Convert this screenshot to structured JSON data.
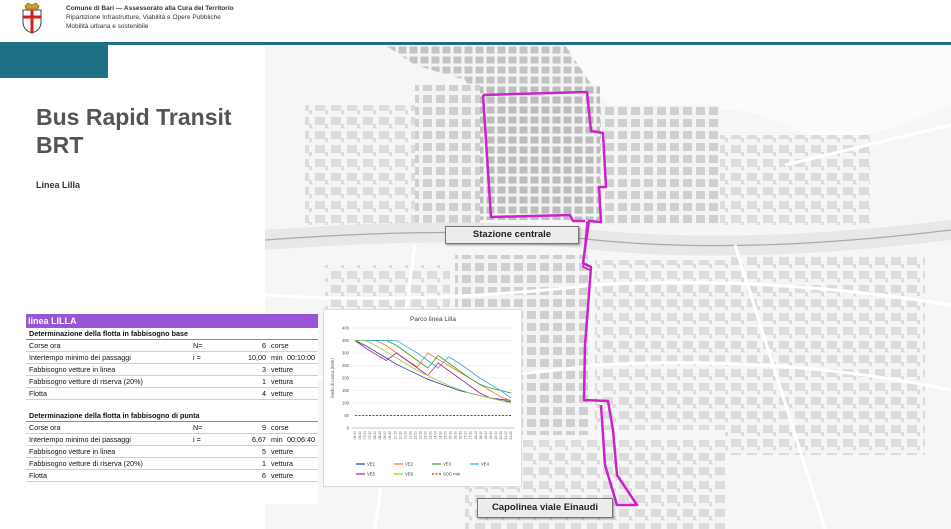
{
  "header": {
    "line1": "Comune di Bari — Assessorato alla Cura del Territorio",
    "line2": "Ripartizione Infrastrutture, Viabilità e Opere Pubbliche",
    "line3": "Mobilità urbana e sostenibile"
  },
  "page": {
    "title_line1": "Bus Rapid Transit",
    "title_line2": "BRT",
    "subtitle": "Linea Lilla"
  },
  "map": {
    "route_color": "#cc22cc",
    "label_station": "Stazione centrale",
    "label_terminal": "Capolinea viale Einaudi"
  },
  "table": {
    "header": "linea LILLA",
    "header_color": "#9955d8",
    "base": {
      "section_title": "Determinazione della flotta in fabbisogno base",
      "rows": [
        {
          "label": "Corse ora",
          "sym": "N=",
          "val": "6",
          "unit": "corse",
          "time": ""
        },
        {
          "label": "Intertempo minimo dei passaggi",
          "sym": "i =",
          "val": "10,00",
          "unit": "min",
          "time": "00:10:00"
        },
        {
          "label": "Fabbisogno vetture in linea",
          "sym": "",
          "val": "3",
          "unit": "vetture",
          "time": ""
        },
        {
          "label": "Fabbisogno vetture di riserva (20%)",
          "sym": "",
          "val": "1",
          "unit": "vettura",
          "time": ""
        },
        {
          "label": "Flotta",
          "sym": "",
          "val": "4",
          "unit": "vetture",
          "time": ""
        }
      ]
    },
    "peak": {
      "section_title": "Determinazione della flotta in fabbisogno di punta",
      "rows": [
        {
          "label": "Corse ora",
          "sym": "N=",
          "val": "9",
          "unit": "corse",
          "time": ""
        },
        {
          "label": "Intertempo minimo dei passaggi",
          "sym": "i =",
          "val": "6,67",
          "unit": "min",
          "time": "00:06:40"
        },
        {
          "label": "Fabbisogno vetture in linea",
          "sym": "",
          "val": "5",
          "unit": "vetture",
          "time": ""
        },
        {
          "label": "Fabbisogno vetture di riserva (20%)",
          "sym": "",
          "val": "1",
          "unit": "vettura",
          "time": ""
        },
        {
          "label": "Flotta",
          "sym": "",
          "val": "6",
          "unit": "vetture",
          "time": ""
        }
      ]
    }
  },
  "chart_data": {
    "type": "line",
    "title": "Parco linea Lilla",
    "ylabel": "livello di carica (kWh)",
    "ylim": [
      0,
      400
    ],
    "yticks": [
      0,
      50,
      100,
      150,
      200,
      250,
      300,
      350,
      400
    ],
    "categories": [
      "06:00",
      "06:30",
      "07:00",
      "07:30",
      "08:00",
      "08:30",
      "09:00",
      "09:30",
      "10:00",
      "10:30",
      "11:00",
      "11:30",
      "12:00",
      "12:30",
      "13:00",
      "13:30",
      "14:00",
      "14:30",
      "15:00",
      "15:30",
      "16:00",
      "16:30",
      "17:00",
      "17:30",
      "18:00",
      "18:30",
      "19:00",
      "19:30",
      "20:00",
      "20:30",
      "21:00",
      "21:30"
    ],
    "series": [
      {
        "name": "VE1",
        "color": "#1f3fa0",
        "values": [
          350,
          330,
          305,
          280,
          255,
          235,
          215,
          195,
          180,
          165,
          150,
          140,
          130,
          120,
          115,
          110
        ]
      },
      {
        "name": "VE2",
        "color": "#ee7722",
        "values": [
          350,
          350,
          350,
          330,
          300,
          270,
          245,
          300,
          275,
          250,
          225,
          200,
          175,
          150,
          125,
          110
        ]
      },
      {
        "name": "VE3",
        "color": "#33a02c",
        "values": [
          350,
          350,
          350,
          350,
          330,
          300,
          270,
          240,
          290,
          260,
          230,
          200,
          175,
          160,
          150,
          140
        ]
      },
      {
        "name": "VE4",
        "color": "#33aadd",
        "values": [
          350,
          350,
          350,
          350,
          350,
          325,
          300,
          270,
          240,
          285,
          260,
          230,
          200,
          175,
          150,
          120
        ]
      },
      {
        "name": "VE5",
        "color": "#aa2299",
        "values": [
          350,
          320,
          295,
          270,
          300,
          270,
          240,
          210,
          260,
          230,
          200,
          170,
          140,
          120,
          110,
          105
        ]
      },
      {
        "name": "VE6",
        "color": "#99cc33",
        "values": [
          350,
          350,
          330,
          305,
          280,
          255,
          230,
          210,
          190,
          170,
          155,
          140,
          130,
          120,
          110,
          100
        ]
      },
      {
        "name": "SOC min",
        "color": "#dd2222",
        "dashed": true,
        "values": [
          50,
          50,
          50,
          50,
          50,
          50,
          50,
          50,
          50,
          50,
          50,
          50,
          50,
          50,
          50,
          50
        ]
      }
    ],
    "legend_position": "bottom",
    "grid": true
  }
}
